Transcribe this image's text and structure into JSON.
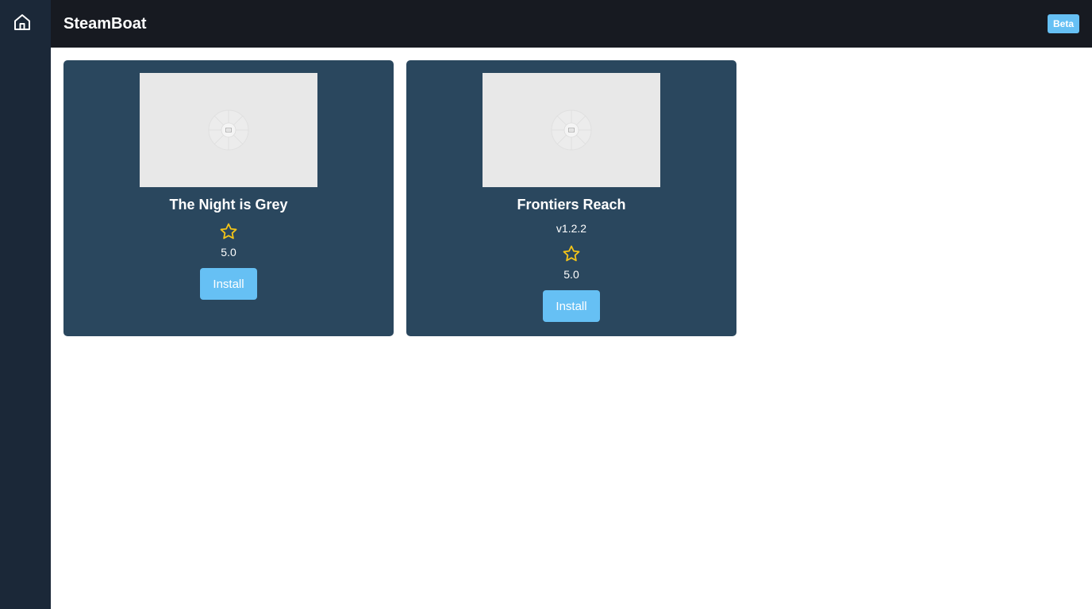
{
  "sidebar": {
    "home_icon": "home-icon"
  },
  "header": {
    "title": "SteamBoat",
    "badge": "Beta"
  },
  "games": [
    {
      "title": "The Night is Grey",
      "version": "",
      "rating": "5.0",
      "install_label": "Install",
      "image_icon": "image-placeholder-icon",
      "star_icon": "star-outline-icon"
    },
    {
      "title": "Frontiers Reach",
      "version": "v1.2.2",
      "rating": "5.0",
      "install_label": "Install",
      "image_icon": "image-placeholder-icon",
      "star_icon": "star-outline-icon"
    }
  ],
  "colors": {
    "sidebar_bg": "#1b2838",
    "header_bg": "#171a21",
    "card_bg": "#2a475e",
    "accent": "#66c0f4",
    "star": "#f5c518"
  }
}
